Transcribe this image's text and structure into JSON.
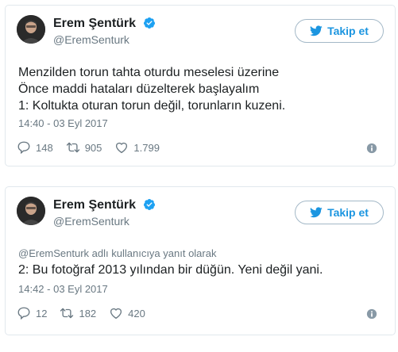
{
  "tweets": [
    {
      "author_name": "Erem Şentürk",
      "author_handle": "@EremSenturk",
      "follow_label": "Takip et",
      "reply_note": "",
      "lines": [
        "Menzilden torun tahta oturdu meselesi üzerine",
        "Önce maddi hataları düzelterek başlayalım",
        "1: Koltukta oturan torun değil, torunların kuzeni."
      ],
      "timestamp": "14:40 - 03 Eyl 2017",
      "reply_count": "148",
      "retweet_count": "905",
      "like_count": "1.799"
    },
    {
      "author_name": "Erem Şentürk",
      "author_handle": "@EremSenturk",
      "follow_label": "Takip et",
      "reply_note": "@EremSenturk adlı kullanıcıya yanıt olarak",
      "lines": [
        "2: Bu fotoğraf 2013 yılından bir düğün. Yeni değil yani."
      ],
      "timestamp": "14:42 - 03 Eyl 2017",
      "reply_count": "12",
      "retweet_count": "182",
      "like_count": "420"
    }
  ],
  "colors": {
    "accent": "#1b95e0",
    "verified": "#1da1f2",
    "muted_text": "#697882",
    "border": "#e1e8ed"
  },
  "icons": [
    "verified-badge-icon",
    "twitter-bird-icon",
    "reply-icon",
    "retweet-icon",
    "like-icon",
    "info-icon"
  ]
}
